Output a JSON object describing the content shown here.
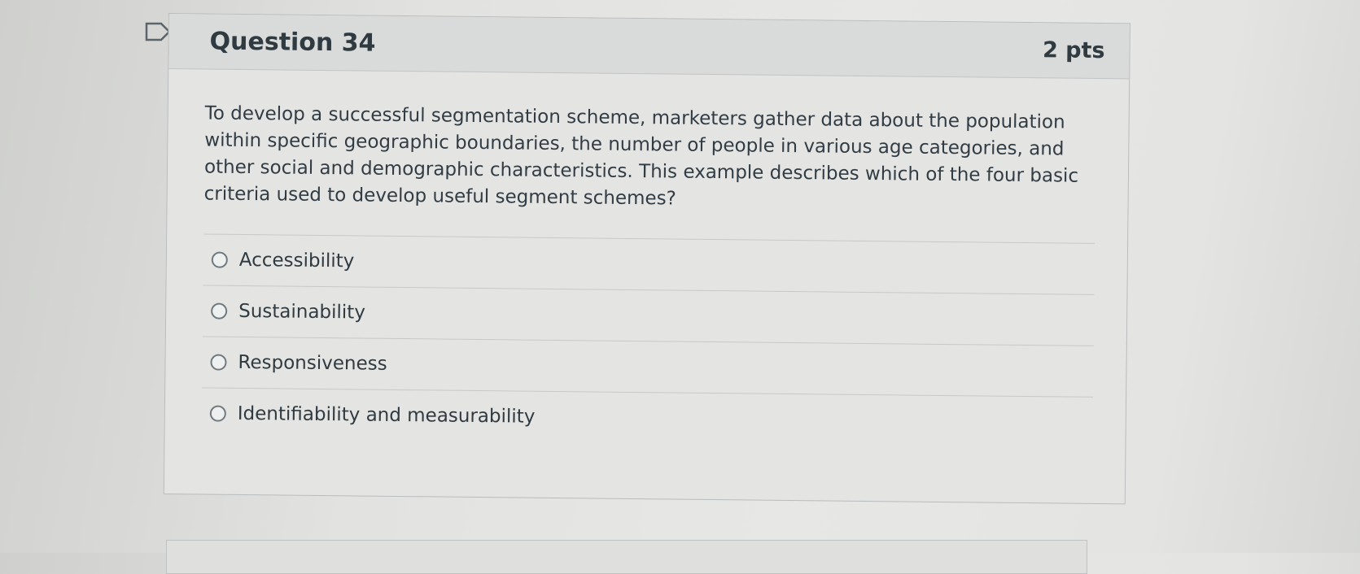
{
  "question": {
    "title": "Question 34",
    "points": "2 pts",
    "text": "To develop a successful segmentation scheme, marketers gather data about the population within specific geographic boundaries, the number of people in various age categories, and other social and demographic characteristics. This example describes which of the four basic criteria used to develop useful segment schemes?",
    "answers": [
      {
        "label": "Accessibility"
      },
      {
        "label": "Sustainability"
      },
      {
        "label": "Responsiveness"
      },
      {
        "label": "Identifiability and measurability"
      }
    ]
  }
}
